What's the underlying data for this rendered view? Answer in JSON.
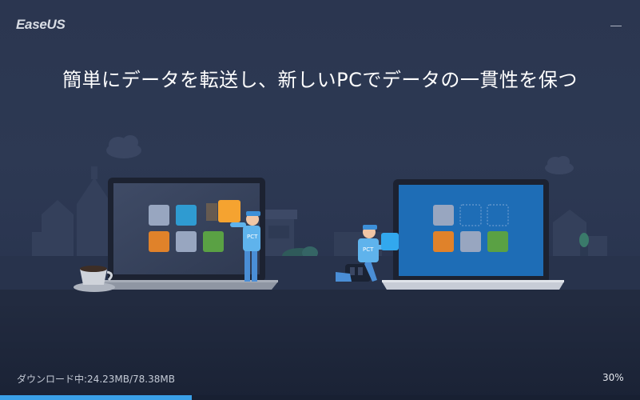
{
  "window": {
    "logo": "EaseUS"
  },
  "headline": "簡単にデータを転送し、新しいPCでデータの一貫性を保つ",
  "illustration": {
    "mascot_badge": "PCT"
  },
  "colors": {
    "accent": "#3aa0e8",
    "background": "#2b3650"
  },
  "icons": [
    "minimize-icon"
  ],
  "status": {
    "download_text": "ダウンロード中:24.23MB/78.38MB",
    "percent_text": "30%",
    "progress": 0.3
  }
}
